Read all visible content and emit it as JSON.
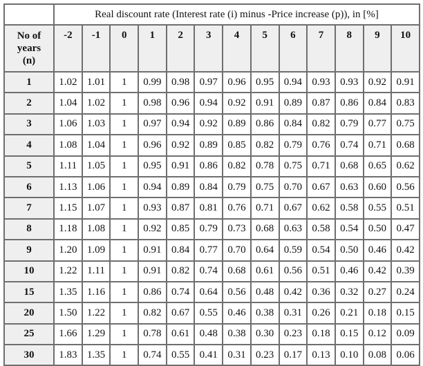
{
  "table": {
    "title": "Real discount rate (Interest rate (i) minus -Price increase (p)), in [%]",
    "corner_label": "",
    "row_header_label": "No of years (n)",
    "row_header_lines": [
      "No of",
      "years",
      "(n)"
    ],
    "columns": [
      "-2",
      "-1",
      "0",
      "1",
      "2",
      "3",
      "4",
      "5",
      "6",
      "7",
      "8",
      "9",
      "10"
    ],
    "rows": [
      {
        "n": "1",
        "values": [
          "1.02",
          "1.01",
          "1",
          "0.99",
          "0.98",
          "0.97",
          "0.96",
          "0.95",
          "0.94",
          "0.93",
          "0.93",
          "0.92",
          "0.91"
        ]
      },
      {
        "n": "2",
        "values": [
          "1.04",
          "1.02",
          "1",
          "0.98",
          "0.96",
          "0.94",
          "0.92",
          "0.91",
          "0.89",
          "0.87",
          "0.86",
          "0.84",
          "0.83"
        ]
      },
      {
        "n": "3",
        "values": [
          "1.06",
          "1.03",
          "1",
          "0.97",
          "0.94",
          "0.92",
          "0.89",
          "0.86",
          "0.84",
          "0.82",
          "0.79",
          "0.77",
          "0.75"
        ]
      },
      {
        "n": "4",
        "values": [
          "1.08",
          "1.04",
          "1",
          "0.96",
          "0.92",
          "0.89",
          "0.85",
          "0.82",
          "0.79",
          "0.76",
          "0.74",
          "0.71",
          "0.68"
        ]
      },
      {
        "n": "5",
        "values": [
          "1.11",
          "1.05",
          "1",
          "0.95",
          "0.91",
          "0.86",
          "0.82",
          "0.78",
          "0.75",
          "0.71",
          "0.68",
          "0.65",
          "0.62"
        ]
      },
      {
        "n": "6",
        "values": [
          "1.13",
          "1.06",
          "1",
          "0.94",
          "0.89",
          "0.84",
          "0.79",
          "0.75",
          "0.70",
          "0.67",
          "0.63",
          "0.60",
          "0.56"
        ]
      },
      {
        "n": "7",
        "values": [
          "1.15",
          "1.07",
          "1",
          "0.93",
          "0.87",
          "0.81",
          "0.76",
          "0.71",
          "0.67",
          "0.62",
          "0.58",
          "0.55",
          "0.51"
        ]
      },
      {
        "n": "8",
        "values": [
          "1.18",
          "1.08",
          "1",
          "0.92",
          "0.85",
          "0.79",
          "0.73",
          "0.68",
          "0.63",
          "0.58",
          "0.54",
          "0.50",
          "0.47"
        ]
      },
      {
        "n": "9",
        "values": [
          "1.20",
          "1.09",
          "1",
          "0.91",
          "0.84",
          "0.77",
          "0.70",
          "0.64",
          "0.59",
          "0.54",
          "0.50",
          "0.46",
          "0.42"
        ]
      },
      {
        "n": "10",
        "values": [
          "1.22",
          "1.11",
          "1",
          "0.91",
          "0.82",
          "0.74",
          "0.68",
          "0.61",
          "0.56",
          "0.51",
          "0.46",
          "0.42",
          "0.39"
        ]
      },
      {
        "n": "15",
        "values": [
          "1.35",
          "1.16",
          "1",
          "0.86",
          "0.74",
          "0.64",
          "0.56",
          "0.48",
          "0.42",
          "0.36",
          "0.32",
          "0.27",
          "0.24"
        ]
      },
      {
        "n": "20",
        "values": [
          "1.50",
          "1.22",
          "1",
          "0.82",
          "0.67",
          "0.55",
          "0.46",
          "0.38",
          "0.31",
          "0.26",
          "0.21",
          "0.18",
          "0.15"
        ]
      },
      {
        "n": "25",
        "values": [
          "1.66",
          "1.29",
          "1",
          "0.78",
          "0.61",
          "0.48",
          "0.38",
          "0.30",
          "0.23",
          "0.18",
          "0.15",
          "0.12",
          "0.09"
        ]
      },
      {
        "n": "30",
        "values": [
          "1.83",
          "1.35",
          "1",
          "0.74",
          "0.55",
          "0.41",
          "0.31",
          "0.23",
          "0.17",
          "0.13",
          "0.10",
          "0.08",
          "0.06"
        ]
      }
    ]
  }
}
